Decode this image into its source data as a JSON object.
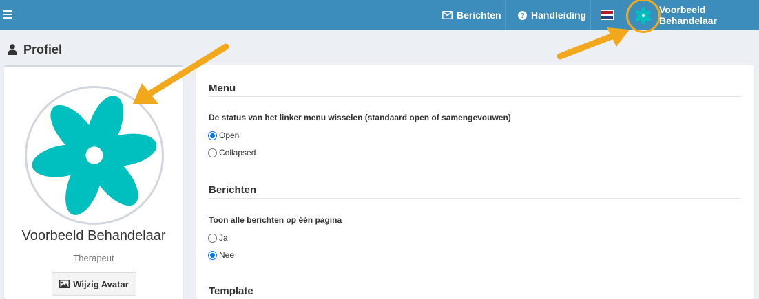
{
  "navbar": {
    "messages_label": "Berichten",
    "manual_label": "Handleiding",
    "language": "Nederlands",
    "user_name": "Voorbeeld Behandelaar",
    "bg_color": "#3c8dbc"
  },
  "page": {
    "title": "Profiel"
  },
  "profile": {
    "name": "Voorbeeld Behandelaar",
    "role": "Therapeut",
    "change_avatar_label": "Wijzig Avatar",
    "avatar_color": "#00bfbf"
  },
  "settings": {
    "menu": {
      "title": "Menu",
      "description": "De status van het linker menu wisselen (standaard open of samengevouwen)",
      "options": [
        {
          "label": "Open",
          "checked": true
        },
        {
          "label": "Collapsed",
          "checked": false
        }
      ]
    },
    "messages": {
      "title": "Berichten",
      "description": "Toon alle berichten op één pagina",
      "options": [
        {
          "label": "Ja",
          "checked": false
        },
        {
          "label": "Nee",
          "checked": true
        }
      ]
    },
    "template": {
      "title": "Template"
    }
  },
  "annotations": {
    "arrow_color": "#f2a81d"
  }
}
